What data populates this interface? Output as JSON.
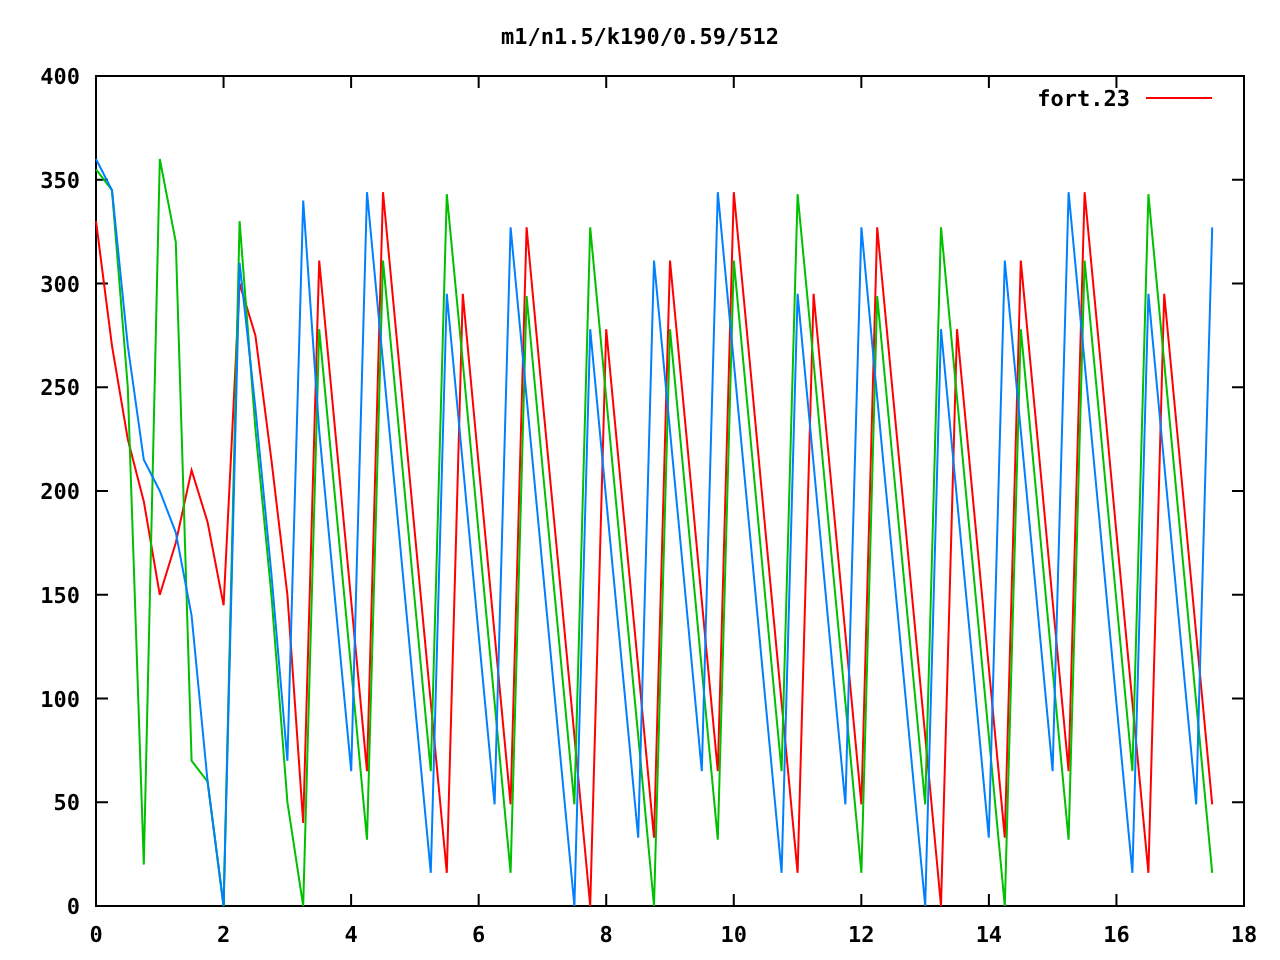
{
  "chart_data": {
    "type": "line",
    "title": "m1/n1.5/k190/0.59/512",
    "xlim": [
      0,
      18
    ],
    "ylim": [
      0,
      400
    ],
    "xticks": [
      0,
      2,
      4,
      6,
      8,
      10,
      12,
      14,
      16,
      18
    ],
    "yticks": [
      0,
      50,
      100,
      150,
      200,
      250,
      300,
      350,
      400
    ],
    "x": [
      0,
      0.25,
      0.5,
      0.75,
      1,
      1.25,
      1.5,
      1.75,
      2,
      2.25,
      2.5,
      2.75,
      3,
      3.25,
      3.5,
      3.75,
      4,
      4.25,
      4.5,
      4.75,
      5,
      5.25,
      5.5,
      5.75,
      6,
      6.25,
      6.5,
      6.75,
      7,
      7.25,
      7.5,
      7.75,
      8,
      8.25,
      8.5,
      8.75,
      9,
      9.25,
      9.5,
      9.75,
      10,
      10.25,
      10.5,
      10.75,
      11,
      11.25,
      11.5,
      11.75,
      12,
      12.25,
      12.5,
      12.75,
      13,
      13.25,
      13.5,
      13.75,
      14,
      14.25,
      14.5,
      14.75,
      15,
      15.25,
      15.5,
      15.75,
      16,
      16.25,
      16.5,
      16.75,
      17,
      17.25,
      17.5
    ],
    "series": [
      {
        "name": "fort.23",
        "color": "#ff0000",
        "values": [
          330,
          270,
          225,
          195,
          150,
          175,
          210,
          185,
          145,
          300,
          275,
          215,
          150,
          40,
          311,
          229,
          147,
          65,
          344,
          262,
          180,
          98,
          16,
          295,
          213,
          131,
          49,
          327,
          245,
          164,
          82,
          0,
          278,
          196,
          115,
          33,
          311,
          229,
          147,
          65,
          344,
          262,
          180,
          98,
          16,
          295,
          213,
          131,
          49,
          327,
          245,
          164,
          82,
          0,
          278,
          196,
          115,
          33,
          311,
          229,
          147,
          65,
          344,
          262,
          180,
          98,
          16,
          295,
          213,
          131,
          49
        ]
      },
      {
        "color": "#00c000",
        "values": [
          355,
          345,
          250,
          20,
          360,
          320,
          70,
          60,
          0,
          330,
          230,
          150,
          50,
          0,
          278,
          196,
          114,
          32,
          311,
          229,
          147,
          65,
          343,
          262,
          180,
          98,
          16,
          294,
          212,
          131,
          49,
          327,
          245,
          163,
          82,
          0,
          278,
          196,
          114,
          32,
          311,
          229,
          147,
          65,
          343,
          262,
          180,
          98,
          16,
          294,
          212,
          131,
          49,
          327,
          245,
          163,
          82,
          0,
          278,
          196,
          114,
          32,
          311,
          229,
          147,
          65,
          343,
          262,
          180,
          98,
          16
        ]
      },
      {
        "color": "#0080ff",
        "values": [
          360,
          345,
          270,
          215,
          200,
          180,
          140,
          60,
          0,
          310,
          240,
          160,
          70,
          340,
          229,
          147,
          65,
          344,
          262,
          180,
          98,
          16,
          295,
          213,
          131,
          49,
          327,
          245,
          164,
          82,
          0,
          278,
          196,
          115,
          33,
          311,
          229,
          147,
          65,
          344,
          262,
          180,
          98,
          16,
          295,
          213,
          131,
          49,
          327,
          245,
          164,
          82,
          0,
          278,
          196,
          115,
          33,
          311,
          229,
          147,
          65,
          344,
          262,
          180,
          98,
          16,
          295,
          213,
          131,
          49,
          327
        ]
      }
    ]
  }
}
